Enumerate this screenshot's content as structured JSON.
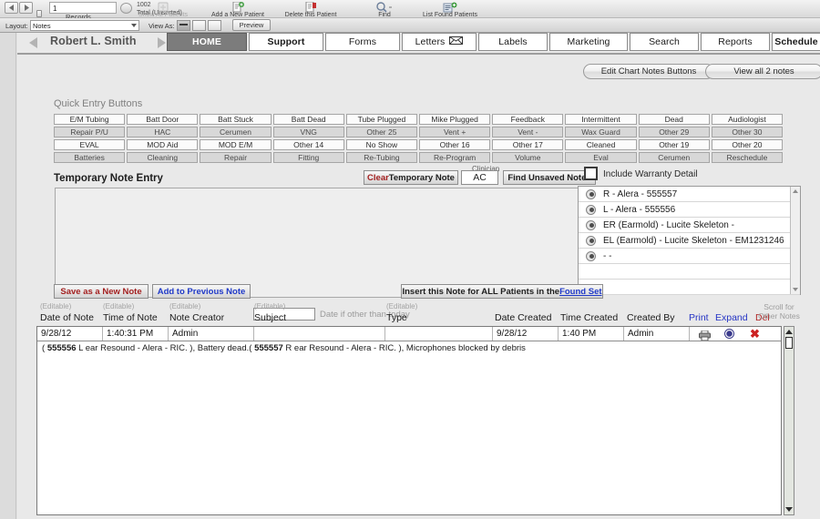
{
  "toolbar": {
    "record_number": "1",
    "records_label": "Records",
    "total_count": "1002",
    "total_label": "Total (Unsorted)",
    "tools": [
      {
        "label": "Show All Patients",
        "icon": "show-all-icon",
        "dim": true
      },
      {
        "label": "Add a New Patient",
        "icon": "add-patient-icon",
        "dim": false
      },
      {
        "label": "Delete this Patient",
        "icon": "delete-patient-icon",
        "dim": false
      },
      {
        "label": "Find",
        "icon": "magnifier-icon",
        "dim": false
      },
      {
        "label": "List Found Patients",
        "icon": "list-found-icon",
        "dim": false
      }
    ],
    "layout_label": "Layout:",
    "layout_value": "Notes",
    "viewas_label": "View As:",
    "preview_label": "Preview"
  },
  "header": {
    "patient_name": "Robert L. Smith",
    "tabs": [
      {
        "label": "HOME",
        "active": true,
        "bold": true,
        "icon": null
      },
      {
        "label": "Support",
        "active": false,
        "bold": true,
        "icon": null
      },
      {
        "label": "Forms",
        "active": false,
        "bold": false,
        "icon": null
      },
      {
        "label": "Letters",
        "active": false,
        "bold": false,
        "icon": "envelope-icon"
      },
      {
        "label": "Labels",
        "active": false,
        "bold": false,
        "icon": null
      },
      {
        "label": "Marketing",
        "active": false,
        "bold": false,
        "icon": null
      },
      {
        "label": "Search",
        "active": false,
        "bold": false,
        "icon": null
      },
      {
        "label": "Reports",
        "active": false,
        "bold": false,
        "icon": null
      },
      {
        "label": "Schedule",
        "active": false,
        "bold": true,
        "icon": null
      }
    ]
  },
  "panel": {
    "edit_chart_notes_label": "Edit Chart Notes Buttons",
    "view_all_notes_label": "View all 2 notes",
    "quick_entry_title": "Quick Entry Buttons",
    "quick_entry_rows": [
      [
        "E/M Tubing",
        "Batt Door",
        "Batt Stuck",
        "Batt Dead",
        "Tube Plugged",
        "Mike Plugged",
        "Feedback",
        "Intermittent",
        "Dead",
        "Audiologist"
      ],
      [
        "Repair P/U",
        "HAC",
        "Cerumen",
        "VNG",
        "Other 25",
        "Vent +",
        "Vent -",
        "Wax Guard",
        "Other 29",
        "Other 30"
      ],
      [
        "EVAL",
        "MOD Aid",
        "MOD E/M",
        "Other 14",
        "No Show",
        "Other 16",
        "Other 17",
        "Cleaned",
        "Other 19",
        "Other 20"
      ],
      [
        "Batteries",
        "Cleaning",
        "Repair",
        "Fitting",
        "Re-Tubing",
        "Re-Program",
        "Volume",
        "Eval",
        "Cerumen",
        "Reschedule"
      ]
    ],
    "temp_note_title": "Temporary Note Entry",
    "clear_note_red": "Clear",
    "clear_note_rest": " Temporary Note",
    "clinician_label": "Clinician",
    "clinician_value": "AC",
    "find_unsaved_label": "Find Unsaved Notes",
    "temp_note_value": "",
    "warranty_checkbox_label": "Include Warranty Detail",
    "warranty_items": [
      "R - Alera - 555557",
      "L - Alera - 555556",
      "ER   (Earmold) - Lucite Skeleton -",
      "EL   (Earmold) - Lucite Skeleton - EM1231246",
      "- -"
    ],
    "save_new_label": "Save as a New Note",
    "add_previous_label": "Add to Previous Note",
    "date_field_value": "",
    "date_hint": "Date if other than today",
    "insert_all_prefix": "Insert this Note for ALL Patients in the ",
    "insert_all_link": "Found Set"
  },
  "notes_table": {
    "editable_tag": "(Editable)",
    "columns": [
      {
        "key": "date_of_note",
        "label": "Date of Note",
        "editable": true
      },
      {
        "key": "time_of_note",
        "label": "Time of Note",
        "editable": true
      },
      {
        "key": "note_creator",
        "label": "Note Creator",
        "editable": true
      },
      {
        "key": "subject",
        "label": "Subject",
        "editable": true
      },
      {
        "key": "type",
        "label": "Type",
        "editable": true
      },
      {
        "key": "date_created",
        "label": "Date Created",
        "editable": false
      },
      {
        "key": "time_created",
        "label": "Time Created",
        "editable": false
      },
      {
        "key": "created_by",
        "label": "Created By",
        "editable": false
      }
    ],
    "action_headers": {
      "print": "Print",
      "expand": "Expand",
      "del": "Del",
      "scroll_hint_line1": "Scroll for",
      "scroll_hint_line2": "Other Notes"
    },
    "rows": [
      {
        "date_of_note": "9/28/12",
        "time_of_note": "1:40:31 PM",
        "note_creator": "Admin",
        "subject": "",
        "type": "",
        "date_created": "9/28/12",
        "time_created": "1:40 PM",
        "created_by": "Admin",
        "body_segments": [
          {
            "text": "( ",
            "bold": false
          },
          {
            "text": "555556",
            "bold": true
          },
          {
            "text": " L ear Resound - Alera - RIC. ), Battery dead.( ",
            "bold": false
          },
          {
            "text": "555557",
            "bold": true
          },
          {
            "text": " R ear Resound - Alera - RIC. ), Microphones blocked by debris",
            "bold": false
          }
        ]
      }
    ]
  },
  "colors": {
    "active_tab_bg": "#7c7c7c",
    "link_blue": "#1f39c8",
    "delete_red": "#cc2222",
    "accent_red": "#a32020",
    "shaded_row": "#d8d8d8"
  }
}
